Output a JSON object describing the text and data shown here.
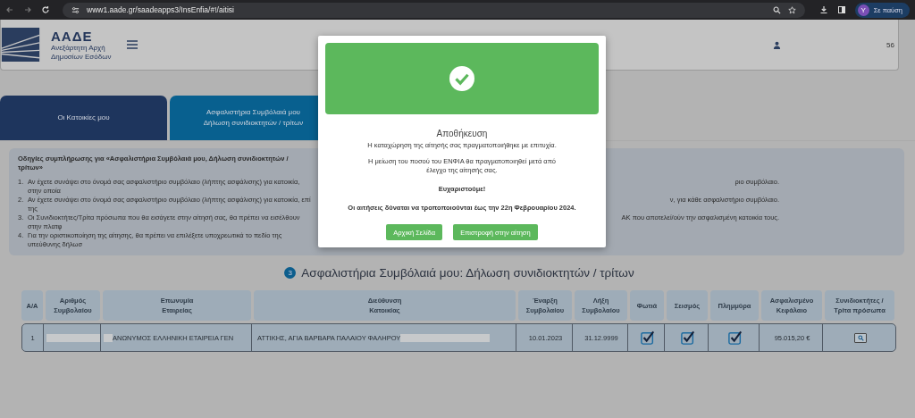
{
  "browser": {
    "url": "www1.aade.gr/saadeapps3/InsEnfia/#!/aitisi",
    "profile": {
      "initial": "Y",
      "label": "Σε παύση"
    }
  },
  "header": {
    "logo_title": "ΑΑΔΕ",
    "logo_lines": [
      "Ανεξάρτητη Αρχή",
      "Δημοσίων Εσόδων"
    ],
    "right_text": "56"
  },
  "tabs": [
    {
      "lines": [
        "Οι Κατοικίες μου"
      ],
      "selected": false
    },
    {
      "lines": [
        "Ασφαλιστήρια Συμβόλαιά μου",
        "Δήλωση συνιδιοκτητών / τρίτων"
      ],
      "selected": true
    }
  ],
  "instructions": {
    "title": "Οδηγίες συμπλήρωσης για «Ασφαλιστήρια Συμβόλαιά μου, Δήλωση συνιδιοκτητών / τρίτων»",
    "items": [
      {
        "number": "1.",
        "text": "Αν έχετε συνάψει στο όνομά σας ασφαλιστήριο συμβόλαιο (λήπτης ασφάλισης) για κατοικία, στην οποία",
        "tail": "ριο συμβόλαιο."
      },
      {
        "number": "2.",
        "text": "Αν έχετε συνάψει στο όνομά σας ασφαλιστήριο συμβόλαιο (λήπτης ασφάλισης) για κατοικία, επί της",
        "tail": "ν, για κάθε ασφαλιστήριο συμβόλαιο."
      },
      {
        "number": "3.",
        "text": "Οι Συνιδιοκτήτες/Τρίτα πρόσωπα που θα εισάγετε στην αίτησή σας, θα πρέπει να εισέλθουν στην πλατφ",
        "tail": "ΑΚ που αποτελεί/ούν την ασφαλισμένη κατοικία τους."
      },
      {
        "number": "4.",
        "text": "Για την οριστικοποίηση της αίτησης, θα πρέπει να επιλέξετε υποχρεωτικά το πεδίο της υπεύθυνης δήλωσ"
      }
    ]
  },
  "section": {
    "step": "3",
    "title": "Ασφαλιστήρια Συμβόλαιά μου: Δήλωση συνιδιοκτητών / τρίτων"
  },
  "table": {
    "columns": [
      "Α/Α",
      "Αριθμός Συμβολαίου",
      "Επωνυμία Εταιρείας",
      "Διεύθυνση Κατοικίας",
      "Έναρξη Συμβολαίου",
      "Λήξη Συμβολαίου",
      "Φωτιά",
      "Σεισμός",
      "Πλημμύρα",
      "Ασφαλισμένο Κεφάλαιο",
      "Συνιδιοκτήτες / Τρίτα πρόσωπα"
    ],
    "rows": [
      {
        "cells": [
          {
            "kind": "text",
            "text": "1"
          },
          {
            "kind": "redacted"
          },
          {
            "kind": "text",
            "text": "ΑΝΩΝΥΜΟΣ ΕΛΛΗΝΙΚΗ ΕΤΑΙΡΕΙΑ ΓΕΝ",
            "redacted_start": true
          },
          {
            "kind": "text",
            "text": "ΑΤΤΙΚΗΣ, ΑΓΙΑ ΒΑΡΒΑΡΑ ΠΑΛΑΙΟΥ ΦΑΛΗΡΟΥ",
            "redacted_end": true
          },
          {
            "kind": "text",
            "text": "10.01.2023"
          },
          {
            "kind": "text",
            "text": "31.12.9999"
          },
          {
            "kind": "check",
            "checked": true
          },
          {
            "kind": "check",
            "checked": true
          },
          {
            "kind": "check",
            "checked": true
          },
          {
            "kind": "text",
            "text": "95.015,20 €"
          },
          {
            "kind": "search"
          }
        ]
      }
    ]
  },
  "dialog": {
    "title": "Αποθήκευση",
    "messages": [
      {
        "lines": [
          "Η καταχώρηση της αίτησής σας πραγματοποιήθηκε με επιτυχία."
        ],
        "bold": false
      },
      {
        "lines": [
          "Η μείωση του ποσού του ΕΝΦΙΑ θα πραγματοποιηθεί μετά από",
          "έλεγχο της αίτησής σας."
        ],
        "bold": false
      },
      {
        "lines": [
          "Ευχαριστούμε!"
        ],
        "bold": true
      },
      {
        "lines": [
          "Οι αιτήσεις δύναται να τροποποιούνται έως την 22η Φεβρουαρίου 2024."
        ],
        "bold": true
      }
    ],
    "buttons": [
      "Αρχική Σελίδα",
      "Επιστροφή στην αίτηση"
    ]
  }
}
